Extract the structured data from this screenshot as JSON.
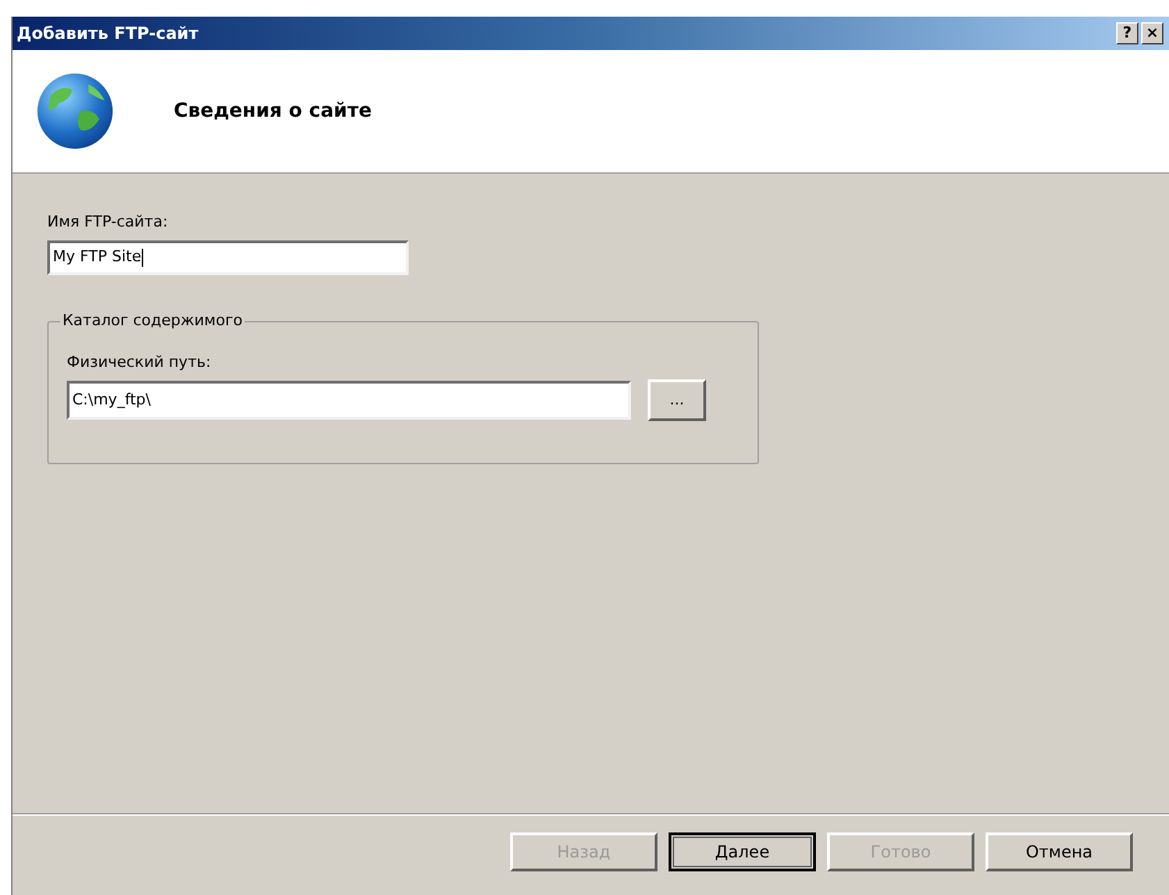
{
  "window": {
    "title": "Добавить FTP-сайт",
    "title_buttons": [
      "?",
      "×"
    ]
  },
  "header": {
    "title": "Сведения о сайте"
  },
  "site_name": {
    "label": "Имя FTP-сайта:",
    "value": "My FTP Site",
    "focused": true
  },
  "content_directory": {
    "legend": "Каталог содержимого",
    "path_label": "Физический путь:",
    "path_value": "C:\\my_ftp\\",
    "browse_button": "..."
  },
  "buttons": [
    {
      "label": "Назад",
      "disabled": true,
      "default": false
    },
    {
      "label": "Далее",
      "disabled": false,
      "default": true
    },
    {
      "label": "Готово",
      "disabled": true,
      "default": false
    },
    {
      "label": "Отмена",
      "disabled": false,
      "default": false
    }
  ]
}
